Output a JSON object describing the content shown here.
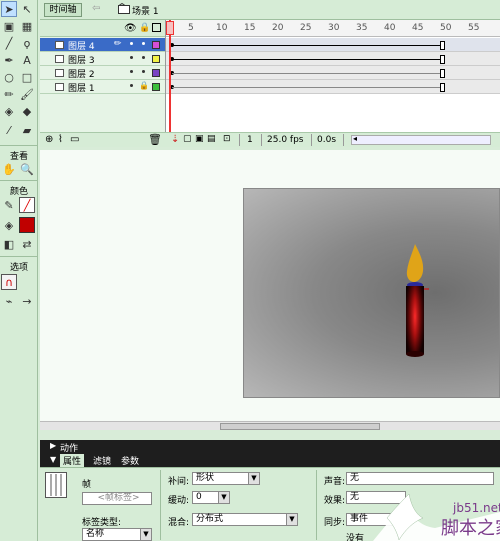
{
  "timeline": {
    "button_label": "时间轴",
    "scene_label": "场景 1",
    "layers": [
      {
        "name": "图层 4",
        "color": "#d64fd6",
        "active": true
      },
      {
        "name": "图层 3",
        "color": "#f2f246",
        "active": false
      },
      {
        "name": "图层 2",
        "color": "#7a44c4",
        "active": false
      },
      {
        "name": "图层 1",
        "color": "#3cc03c",
        "active": false
      }
    ],
    "ruler_ticks": [
      "5",
      "10",
      "15",
      "20",
      "25",
      "30",
      "35",
      "40",
      "45",
      "50",
      "55"
    ],
    "current_frame": "1",
    "fps": "25.0 fps",
    "time": "0.0s"
  },
  "toolbar": {
    "view_label": "查看",
    "colors_label": "颜色",
    "options_label": "选项"
  },
  "panels": {
    "actions_label": "动作",
    "tabs": [
      "属性",
      "滤镜",
      "参数"
    ],
    "frame_label": "帧",
    "frame_name_placeholder": "<帧标签>",
    "label_type_label": "标签类型:",
    "label_type_value": "名称",
    "tween_label": "补间:",
    "tween_value": "形状",
    "ease_label": "缓动:",
    "ease_value": "0",
    "blend_label": "混合:",
    "blend_value": "分布式",
    "sound_label": "声音:",
    "sound_value": "无",
    "effect_label": "效果:",
    "effect_value": "无",
    "sync_label": "同步:",
    "sync_value": "事件",
    "no_sound_text": "没有"
  },
  "watermark": {
    "site": "jb51.net",
    "brand": "脚本之家"
  },
  "colors": {
    "stroke_swatch": "#333333",
    "fill_swatch": "#c00000",
    "candle_flame": "#e0a418",
    "candle_body": "#b01010"
  }
}
